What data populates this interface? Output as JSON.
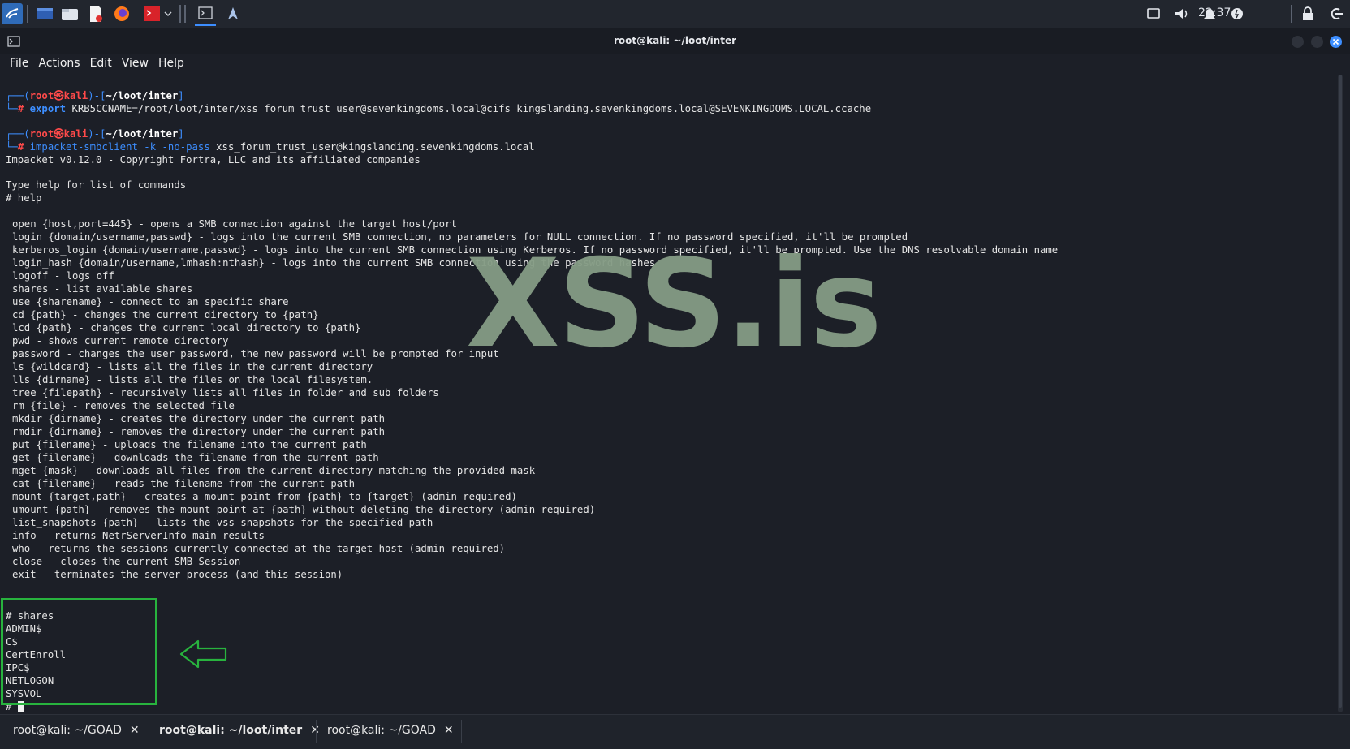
{
  "taskbar": {
    "clock": "22:37"
  },
  "window": {
    "title": "root@kali: ~/loot/inter"
  },
  "menu": [
    "File",
    "Actions",
    "Edit",
    "View",
    "Help"
  ],
  "prompt": {
    "user": "root",
    "host": "kali",
    "cwd": "~/loot/inter"
  },
  "commands": {
    "export_kw": "export",
    "export_args": "KRB5CCNAME=/root/loot/inter/xss_forum_trust_user@sevenkingdoms.local@cifs_kingslanding.sevenkingdoms.local@SEVENKINGDOMS.LOCAL.ccache",
    "smb_cmd": "impacket-smbclient",
    "smb_flags": "-k -no-pass",
    "smb_target": "xss_forum_trust_user@kingslanding.sevenkingdoms.local"
  },
  "output": {
    "banner": "Impacket v0.12.0 - Copyright Fortra, LLC and its affiliated companies",
    "hint": "Type help for list of commands",
    "help_cmd": "# help",
    "help_lines": [
      "open {host,port=445} - opens a SMB connection against the target host/port",
      "login {domain/username,passwd} - logs into the current SMB connection, no parameters for NULL connection. If no password specified, it'll be prompted",
      "kerberos_login {domain/username,passwd} - logs into the current SMB connection using Kerberos. If no password specified, it'll be prompted. Use the DNS resolvable domain name",
      "login_hash {domain/username,lmhash:nthash} - logs into the current SMB connection using the password hashes",
      "logoff - logs off",
      "shares - list available shares",
      "use {sharename} - connect to an specific share",
      "cd {path} - changes the current directory to {path}",
      "lcd {path} - changes the current local directory to {path}",
      "pwd - shows current remote directory",
      "password - changes the user password, the new password will be prompted for input",
      "ls {wildcard} - lists all the files in the current directory",
      "lls {dirname} - lists all the files on the local filesystem.",
      "tree {filepath} - recursively lists all files in folder and sub folders",
      "rm {file} - removes the selected file",
      "mkdir {dirname} - creates the directory under the current path",
      "rmdir {dirname} - removes the directory under the current path",
      "put {filename} - uploads the filename into the current path",
      "get {filename} - downloads the filename from the current path",
      "mget {mask} - downloads all files from the current directory matching the provided mask",
      "cat {filename} - reads the filename from the current path",
      "mount {target,path} - creates a mount point from {path} to {target} (admin required)",
      "umount {path} - removes the mount point at {path} without deleting the directory (admin required)",
      "list_snapshots {path} - lists the vss snapshots for the specified path",
      "info - returns NetrServerInfo main results",
      "who - returns the sessions currently connected at the target host (admin required)",
      "close - closes the current SMB Session",
      "exit - terminates the server process (and this session)"
    ],
    "shares_cmd": "# shares",
    "shares": [
      "ADMIN$",
      "C$",
      "CertEnroll",
      "IPC$",
      "NETLOGON",
      "SYSVOL"
    ],
    "final_prompt": "#"
  },
  "watermark": "XSS.is",
  "tabs": [
    {
      "label": "root@kali: ~/GOAD",
      "active": false
    },
    {
      "label": "root@kali: ~/loot/inter",
      "active": true
    },
    {
      "label": "root@kali: ~/GOAD",
      "active": false
    }
  ],
  "tab_close_glyph": "✕",
  "colors": {
    "background": "#1c1f27",
    "prompt_red": "#ff4a4a",
    "prompt_blue": "#3d8eff",
    "highlight_green": "#28b33e",
    "watermark": "#859c85"
  }
}
